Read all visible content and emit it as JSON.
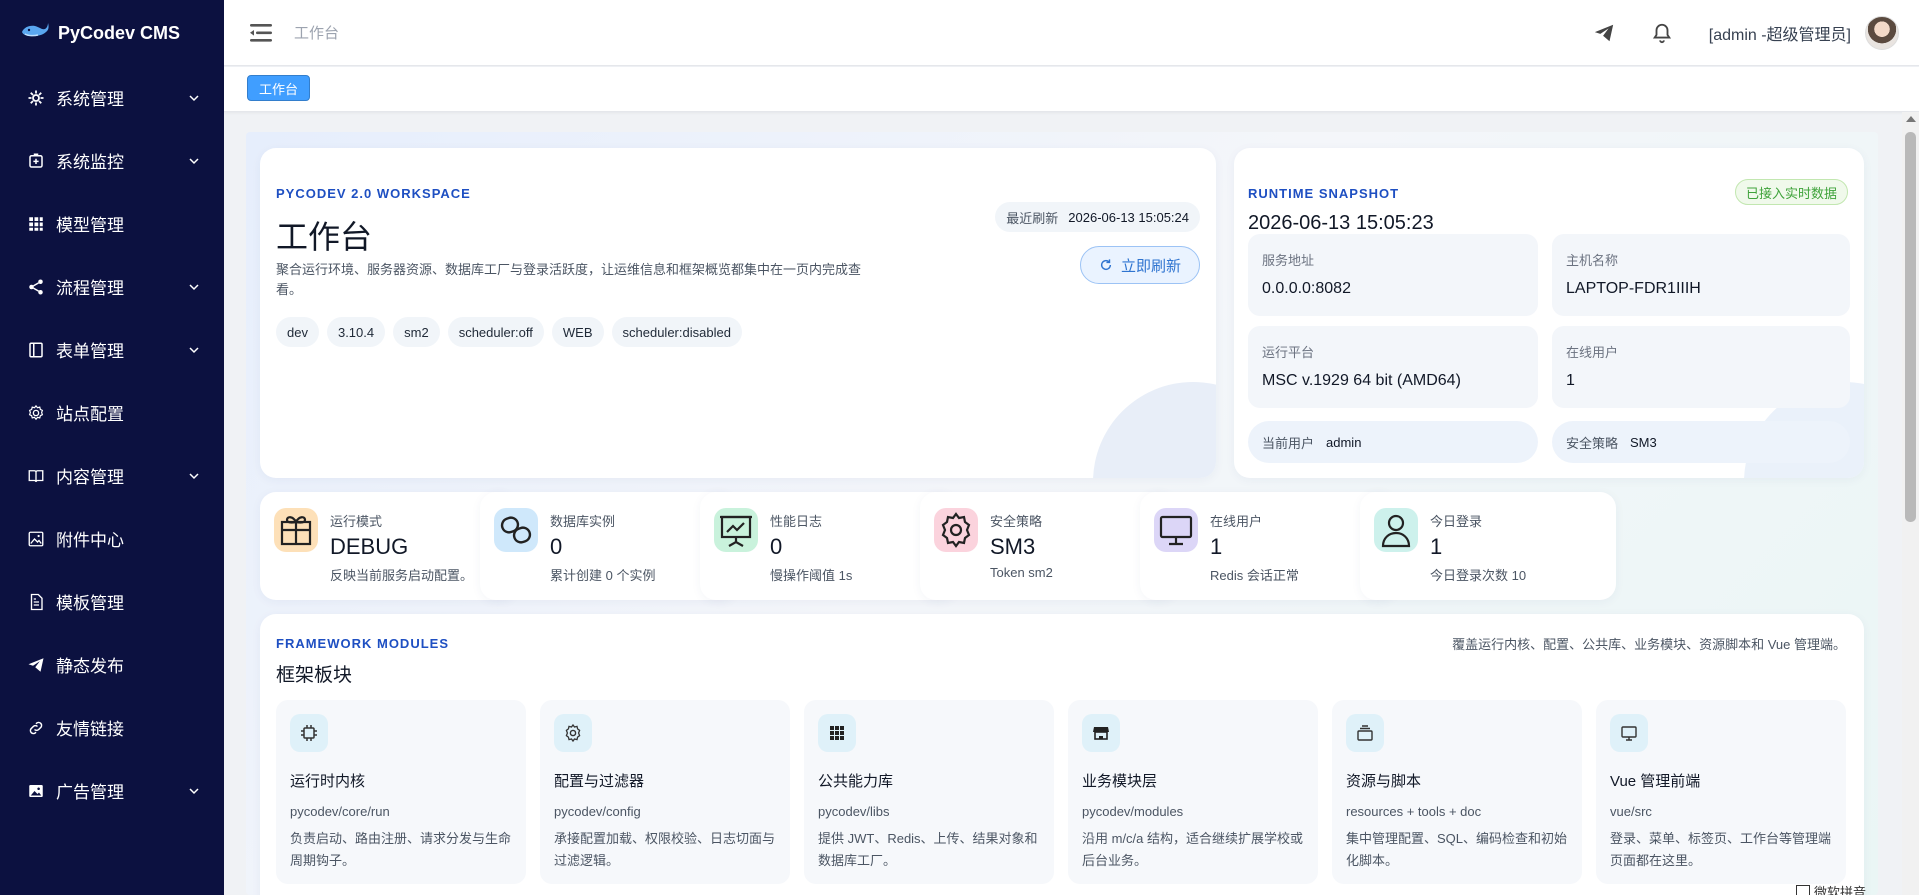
{
  "app": {
    "title": "PyCodev CMS"
  },
  "sidebar": {
    "items": [
      {
        "label": "系统管理",
        "icon": "gear-icon",
        "has_children": true
      },
      {
        "label": "系统监控",
        "icon": "monitor-plus-icon",
        "has_children": true
      },
      {
        "label": "模型管理",
        "icon": "grid-icon",
        "has_children": false
      },
      {
        "label": "流程管理",
        "icon": "share-icon",
        "has_children": true
      },
      {
        "label": "表单管理",
        "icon": "form-icon",
        "has_children": true
      },
      {
        "label": "站点配置",
        "icon": "cog-outline-icon",
        "has_children": false
      },
      {
        "label": "内容管理",
        "icon": "book-icon",
        "has_children": true
      },
      {
        "label": "附件中心",
        "icon": "image-icon",
        "has_children": false
      },
      {
        "label": "模板管理",
        "icon": "document-icon",
        "has_children": false
      },
      {
        "label": "静态发布",
        "icon": "send-icon",
        "has_children": false
      },
      {
        "label": "友情链接",
        "icon": "link-icon",
        "has_children": false
      },
      {
        "label": "广告管理",
        "icon": "picture-icon",
        "has_children": true
      }
    ]
  },
  "header": {
    "breadcrumb": "工作台",
    "user": "[admin -超级管理员]"
  },
  "tags": {
    "active": "工作台"
  },
  "workspace": {
    "eyebrow": "PYCODEV 2.0 WORKSPACE",
    "title": "工作台",
    "description": "聚合运行环境、服务器资源、数据库工厂与登录活跃度，让运维信息和框架概览都集中在一页内完成查看。",
    "chips": [
      "dev",
      "3.10.4",
      "sm2",
      "scheduler:off",
      "WEB",
      "scheduler:disabled"
    ],
    "refresh_label": "最近刷新",
    "refresh_time": "2026-06-13 15:05:24",
    "refresh_button": "立即刷新"
  },
  "runtime": {
    "eyebrow": "RUNTIME SNAPSHOT",
    "time": "2026-06-13 15:05:23",
    "badge": "已接入实时数据",
    "server_address_label": "服务地址",
    "server_address": "0.0.0.0:8082",
    "host_label": "主机名称",
    "host": "LAPTOP-FDR1IIIH",
    "platform_label": "运行平台",
    "platform": "MSC v.1929 64 bit (AMD64)",
    "online_label": "在线用户",
    "online": "1",
    "current_user_label": "当前用户",
    "current_user": "admin",
    "security_label": "安全策略",
    "security": "SM3"
  },
  "stats": [
    {
      "label": "运行模式",
      "value": "DEBUG",
      "sub": "反映当前服务启动配置。",
      "icon": "gift-icon",
      "color": "#fde0b8"
    },
    {
      "label": "数据库实例",
      "value": "0",
      "sub": "累计创建 0 个实例",
      "icon": "link-chain-icon",
      "color": "#cfe8fb"
    },
    {
      "label": "性能日志",
      "value": "0",
      "sub": "慢操作阈值 1s",
      "icon": "presentation-icon",
      "color": "#c9f2dc"
    },
    {
      "label": "安全策略",
      "value": "SM3",
      "sub": "Token sm2",
      "icon": "settings-icon",
      "color": "#fbd3dd"
    },
    {
      "label": "在线用户",
      "value": "1",
      "sub": "Redis 会话正常",
      "icon": "monitor-icon",
      "color": "#dcd6f7"
    },
    {
      "label": "今日登录",
      "value": "1",
      "sub": "今日登录次数 10",
      "icon": "user-icon",
      "color": "#cdf1ec"
    }
  ],
  "framework": {
    "eyebrow": "FRAMEWORK MODULES",
    "title": "框架板块",
    "note": "覆盖运行内核、配置、公共库、业务模块、资源脚本和 Vue 管理端。",
    "modules": [
      {
        "title": "运行时内核",
        "path": "pycodev/core/run",
        "desc": "负责启动、路由注册、请求分发与生命周期钩子。",
        "icon": "chip-icon"
      },
      {
        "title": "配置与过滤器",
        "path": "pycodev/config",
        "desc": "承接配置加载、权限校验、日志切面与过滤逻辑。",
        "icon": "settings-icon"
      },
      {
        "title": "公共能力库",
        "path": "pycodev/libs",
        "desc": "提供 JWT、Redis、上传、结果对象和数据库工厂。",
        "icon": "grid-icon"
      },
      {
        "title": "业务模块层",
        "path": "pycodev/modules",
        "desc": "沿用 m/c/a 结构，适合继续扩展学校或后台业务。",
        "icon": "store-icon"
      },
      {
        "title": "资源与脚本",
        "path": "resources + tools + doc",
        "desc": "集中管理配置、SQL、编码检查和初始化脚本。",
        "icon": "layers-icon"
      },
      {
        "title": "Vue 管理前端",
        "path": "vue/src",
        "desc": "登录、菜单、标签页、工作台等管理端页面都在这里。",
        "icon": "monitor-icon"
      }
    ]
  },
  "floating": {
    "text": "微软拼音"
  }
}
